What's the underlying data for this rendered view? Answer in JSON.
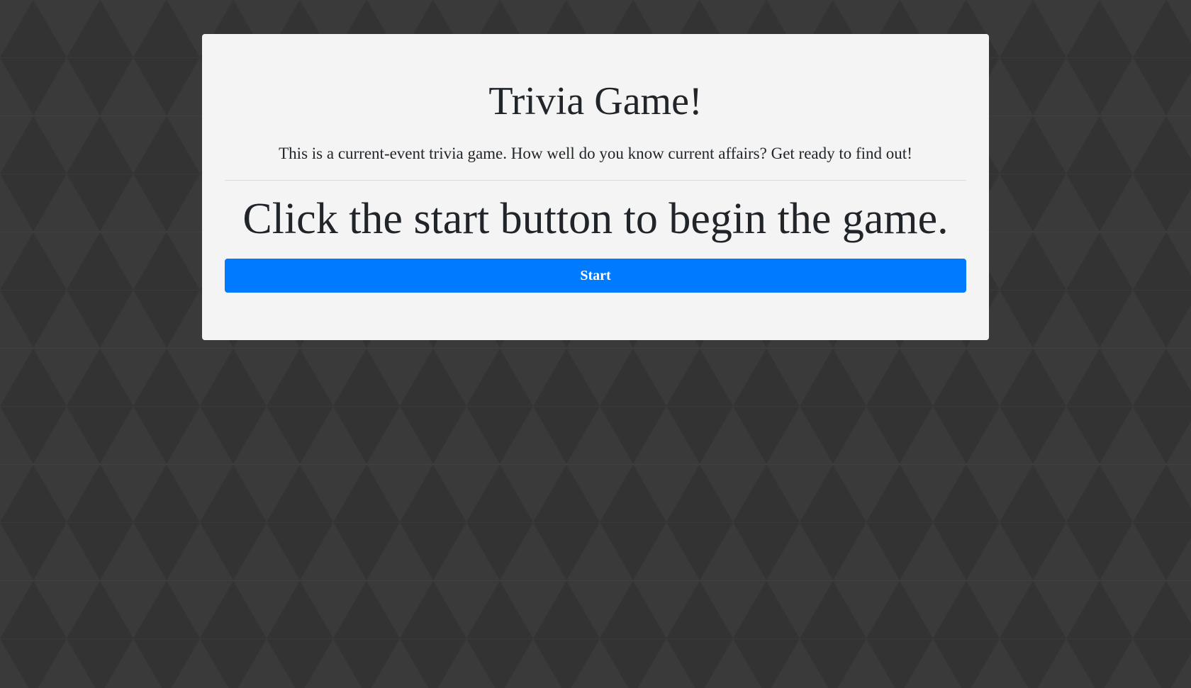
{
  "header": {
    "title": "Trivia Game!",
    "description": "This is a current-event trivia game. How well do you know current affairs? Get ready to find out!"
  },
  "main": {
    "prompt": "Click the start button to begin the game.",
    "start_label": "Start"
  },
  "colors": {
    "page_background": "#333333",
    "card_background": "#f4f4f4",
    "button_primary": "#007bff",
    "button_text": "#ffffff",
    "text": "#212529"
  }
}
